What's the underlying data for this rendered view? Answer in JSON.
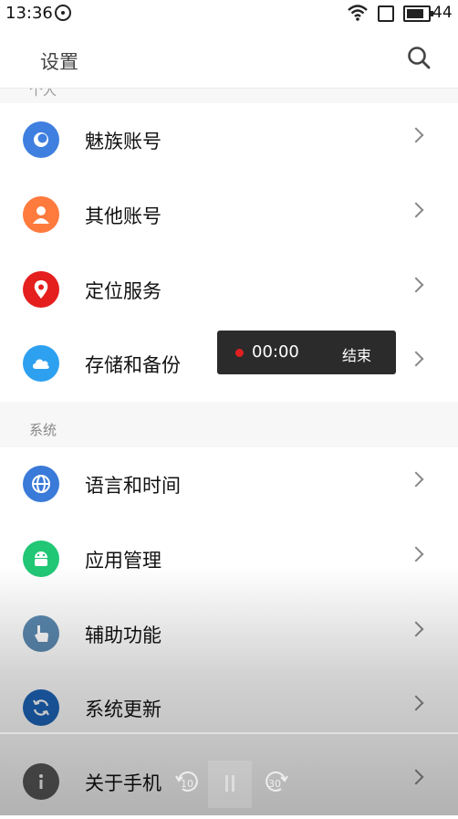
{
  "status": {
    "time": "13:36",
    "battery": "44"
  },
  "header": {
    "title": "设置"
  },
  "sections": {
    "personal_label": "个人",
    "system_label": "系统"
  },
  "items": [
    {
      "label": "魅族账号",
      "icon": "flyme-account-icon",
      "color": "#3f7fe0"
    },
    {
      "label": "其他账号",
      "icon": "person-icon",
      "color": "#ff7a3d"
    },
    {
      "label": "定位服务",
      "icon": "location-pin-icon",
      "color": "#e51e1e"
    },
    {
      "label": "存储和备份",
      "icon": "cloud-icon",
      "color": "#2ea0f0"
    },
    {
      "label": "语言和时间",
      "icon": "globe-icon",
      "color": "#3a7ad8"
    },
    {
      "label": "应用管理",
      "icon": "android-icon",
      "color": "#21c775"
    },
    {
      "label": "辅助功能",
      "icon": "hand-icon",
      "color": "#5b89b0"
    },
    {
      "label": "系统更新",
      "icon": "refresh-icon",
      "color": "#1d64b8"
    },
    {
      "label": "关于手机",
      "icon": "info-icon",
      "color": "#5a5a5a"
    }
  ],
  "recorder": {
    "time": "00:00",
    "end_label": "结束"
  },
  "player": {
    "back_seconds": "10",
    "forward_seconds": "30"
  }
}
